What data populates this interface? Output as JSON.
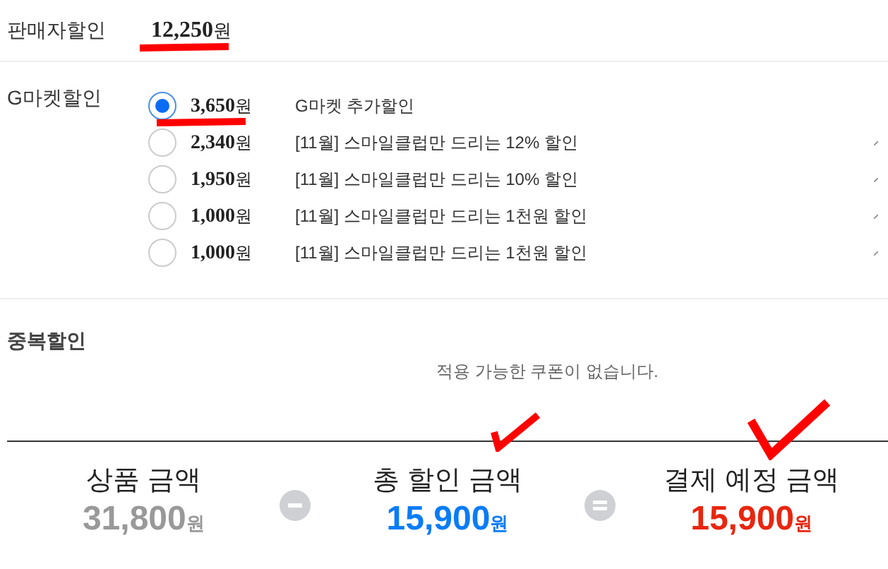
{
  "seller_discount": {
    "label": "판매자할인",
    "amount": "12,250",
    "unit": "원"
  },
  "gmarket_discount": {
    "label": "G마켓할인",
    "options": [
      {
        "amount": "3,650",
        "unit": "원",
        "description": "G마켓 추가할인",
        "selected": true
      },
      {
        "amount": "2,340",
        "unit": "원",
        "description": "[11월] 스마일클럽만 드리는 12% 할인",
        "selected": false
      },
      {
        "amount": "1,950",
        "unit": "원",
        "description": "[11월] 스마일클럽만 드리는 10% 할인",
        "selected": false
      },
      {
        "amount": "1,000",
        "unit": "원",
        "description": "[11월] 스마일클럽만 드리는 1천원 할인",
        "selected": false
      },
      {
        "amount": "1,000",
        "unit": "원",
        "description": "[11월] 스마일클럽만 드리는 1천원 할인",
        "selected": false
      }
    ]
  },
  "duplicate_discount": {
    "label": "중복할인",
    "message": "적용 가능한 쿠폰이 없습니다."
  },
  "summary": [
    {
      "kind": "total",
      "label": "상품 금액",
      "amount": "31,800",
      "unit": "원",
      "color": "#999999"
    },
    {
      "kind": "minus"
    },
    {
      "kind": "total",
      "label": "총 할인 금액",
      "amount": "15,900",
      "unit": "원",
      "color": "#0a7cf7"
    },
    {
      "kind": "equals"
    },
    {
      "kind": "total",
      "label": "결제 예정 금액",
      "amount": "15,900",
      "unit": "원",
      "color": "#e8260f"
    }
  ]
}
